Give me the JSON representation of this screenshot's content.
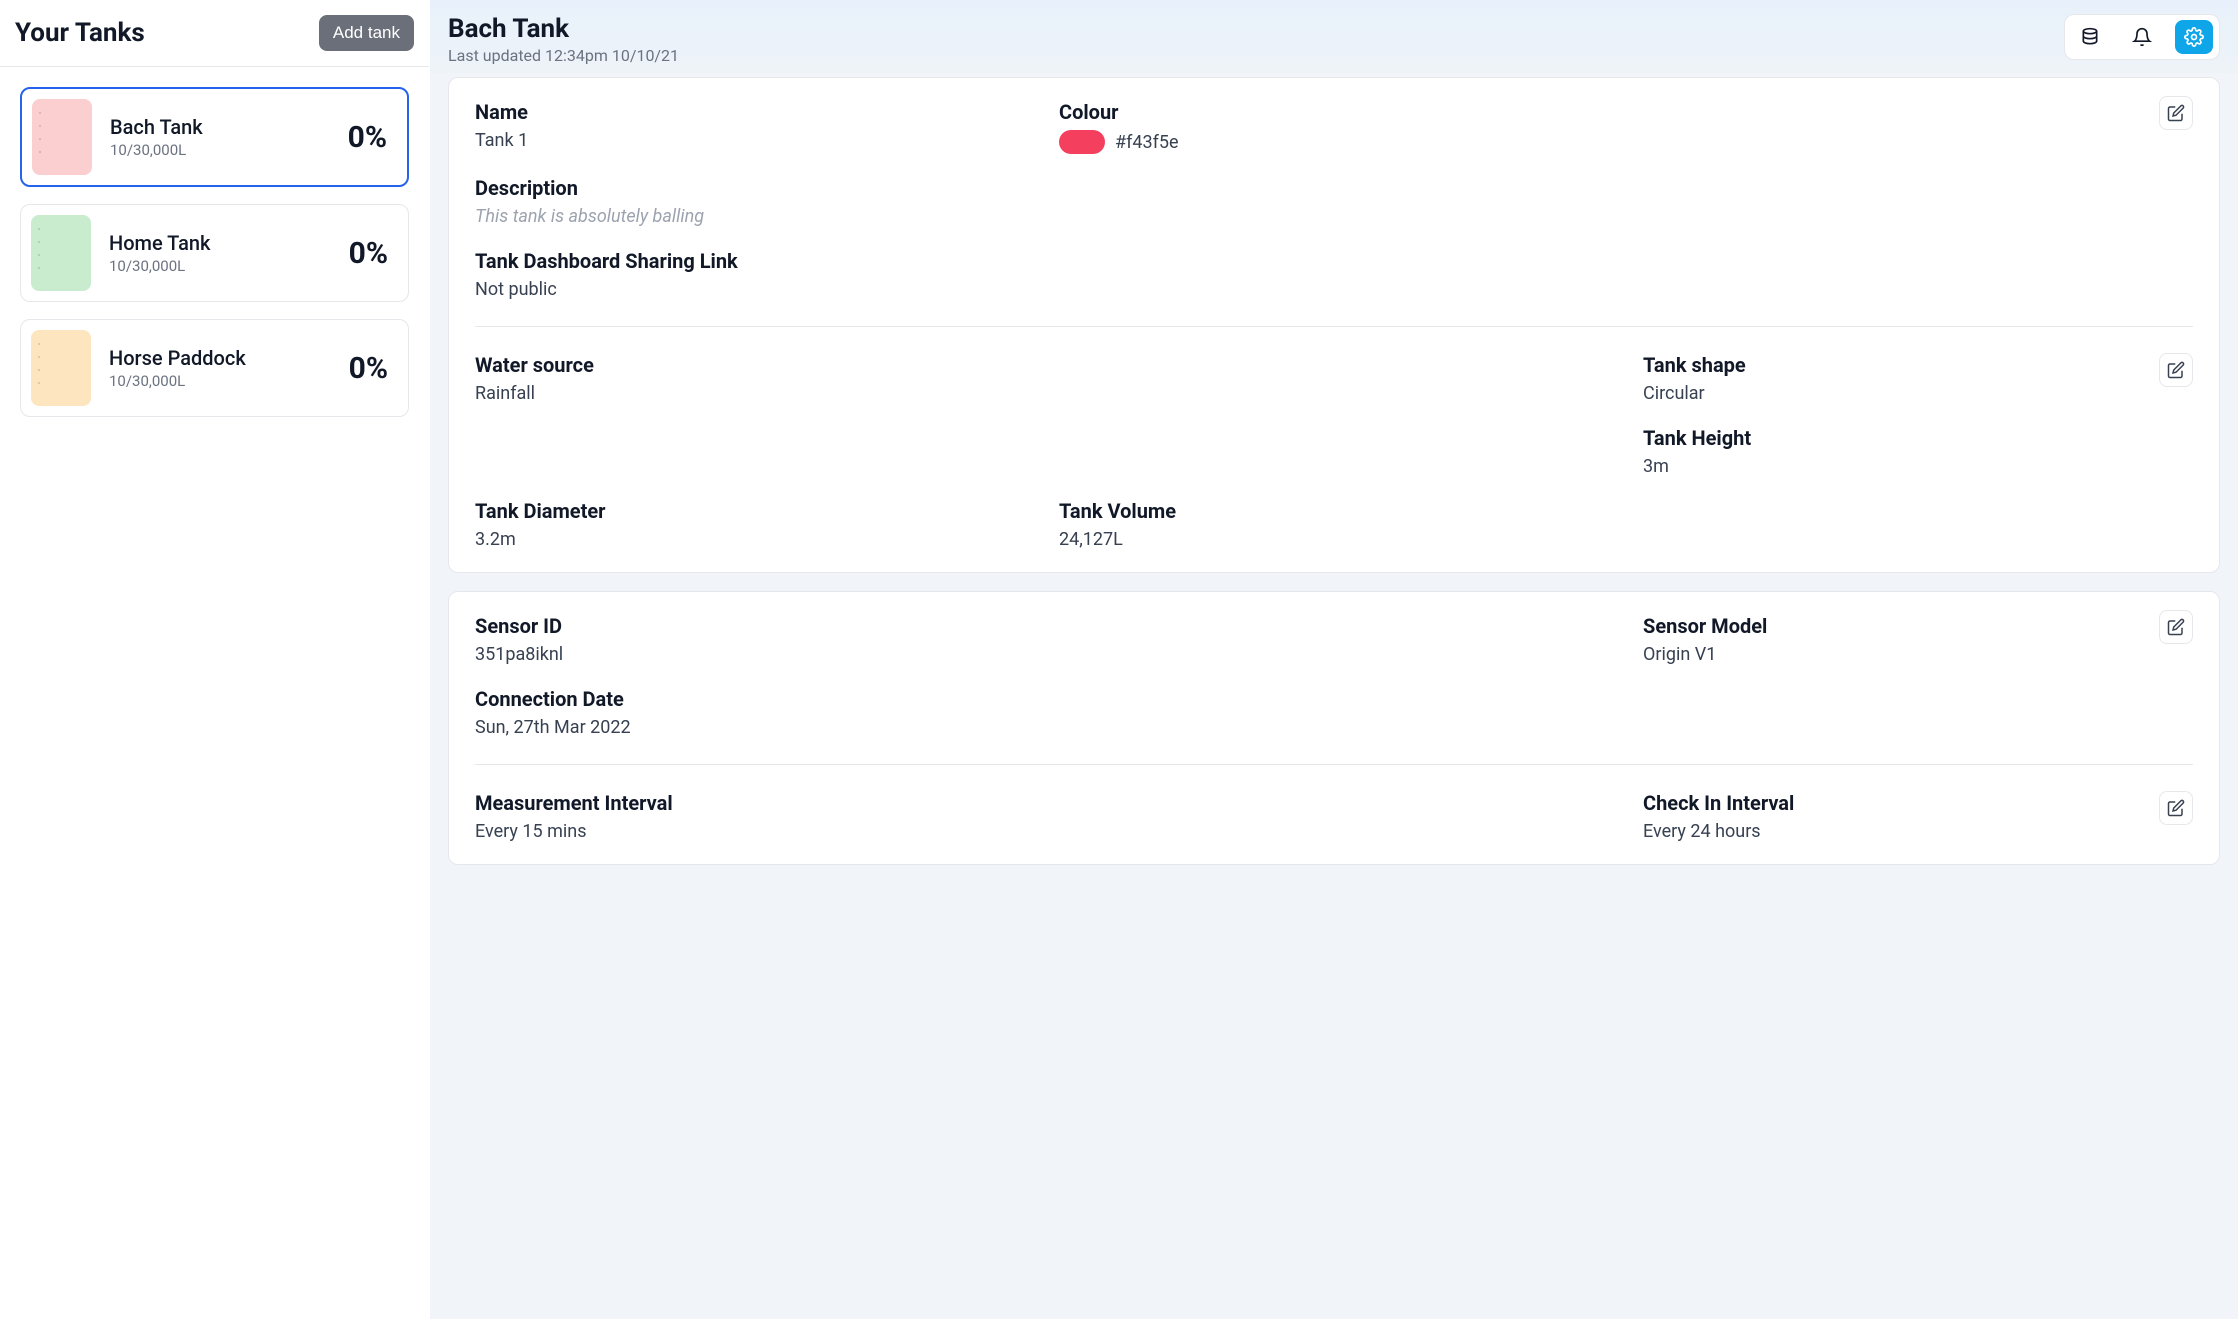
{
  "sidebar": {
    "title": "Your Tanks",
    "add_label": "Add tank",
    "tanks": [
      {
        "name": "Bach Tank",
        "sub": "10/30,000L",
        "pct": "0%",
        "swatch": "#fbcfd0",
        "selected": true
      },
      {
        "name": "Home Tank",
        "sub": "10/30,000L",
        "pct": "0%",
        "swatch": "#c9eccf",
        "selected": false
      },
      {
        "name": "Horse Paddock",
        "sub": "10/30,000L",
        "pct": "0%",
        "swatch": "#fde6bf",
        "selected": false
      }
    ]
  },
  "header": {
    "title": "Bach Tank",
    "updated_prefix": "Last updated ",
    "updated_value": "12:34pm 10/10/21"
  },
  "card1": {
    "sec1": {
      "name_label": "Name",
      "name_value": "Tank 1",
      "colour_label": "Colour",
      "colour_hex": "#f43f5e",
      "description_label": "Description",
      "description_value": "This tank is absolutely balling",
      "sharing_label": "Tank Dashboard Sharing Link",
      "sharing_value": "Not public"
    },
    "sec2": {
      "water_source_label": "Water source",
      "water_source_value": "Rainfall",
      "tank_shape_label": "Tank shape",
      "tank_shape_value": "Circular",
      "tank_height_label": "Tank Height",
      "tank_height_value": "3m",
      "tank_diameter_label": "Tank Diameter",
      "tank_diameter_value": "3.2m",
      "tank_volume_label": "Tank Volume",
      "tank_volume_value": "24,127L"
    }
  },
  "card2": {
    "sec1": {
      "sensor_id_label": "Sensor ID",
      "sensor_id_value": "351pa8iknl",
      "sensor_model_label": "Sensor Model",
      "sensor_model_value": "Origin V1",
      "connection_date_label": "Connection Date",
      "connection_date_value": "Sun, 27th Mar 2022"
    },
    "sec2": {
      "measurement_interval_label": "Measurement Interval",
      "measurement_interval_value": "Every 15 mins",
      "checkin_interval_label": "Check In Interval",
      "checkin_interval_value": "Every 24 hours"
    }
  }
}
